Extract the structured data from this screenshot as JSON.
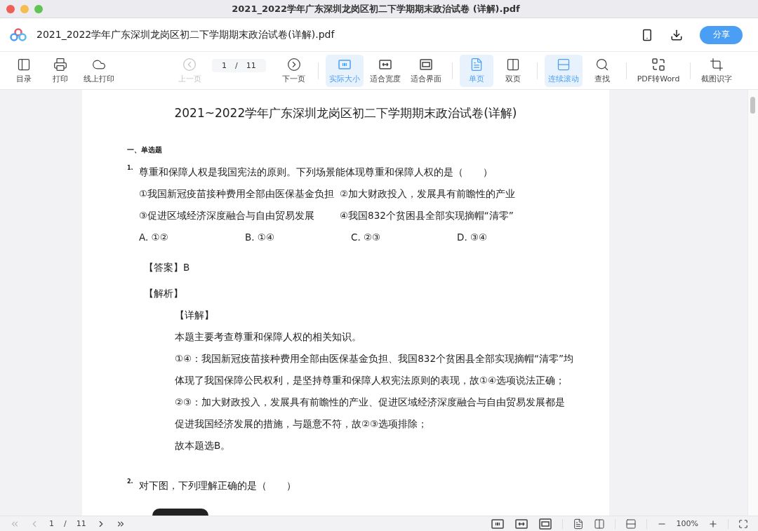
{
  "window": {
    "title": "2021_2022学年广东深圳龙岗区初二下学期期末政治试卷 (详解).pdf"
  },
  "header": {
    "file_name": "2021_2022学年广东深圳龙岗区初二下学期期末政治试卷(详解).pdf",
    "share_button": "分享"
  },
  "toolbar": [
    {
      "kind": "button",
      "label": "目录",
      "selected": false,
      "disabled": false
    },
    {
      "kind": "button",
      "label": "打印",
      "selected": false,
      "disabled": false
    },
    {
      "kind": "button",
      "label": "线上打印",
      "selected": false,
      "disabled": false
    },
    {
      "kind": "spacer"
    },
    {
      "kind": "button",
      "label": "上一页",
      "selected": false,
      "disabled": true
    },
    {
      "kind": "pager",
      "current": "1",
      "separator": "/",
      "total": "11"
    },
    {
      "kind": "button",
      "label": "下一页",
      "selected": false,
      "disabled": false
    },
    {
      "kind": "divider"
    },
    {
      "kind": "button",
      "label": "实际大小",
      "selected": true,
      "disabled": false
    },
    {
      "kind": "button",
      "label": "适合宽度",
      "selected": false,
      "disabled": false
    },
    {
      "kind": "button",
      "label": "适合界面",
      "selected": false,
      "disabled": false
    },
    {
      "kind": "divider"
    },
    {
      "kind": "button",
      "label": "单页",
      "selected": true,
      "disabled": false
    },
    {
      "kind": "button",
      "label": "双页",
      "selected": false,
      "disabled": false
    },
    {
      "kind": "divider"
    },
    {
      "kind": "button",
      "label": "连续滚动",
      "selected": true,
      "disabled": false
    },
    {
      "kind": "button",
      "label": "查找",
      "selected": false,
      "disabled": false
    },
    {
      "kind": "divider"
    },
    {
      "kind": "button",
      "label": "PDF转Word",
      "selected": false,
      "disabled": false
    },
    {
      "kind": "divider"
    },
    {
      "kind": "button",
      "label": "截图识字",
      "selected": false,
      "disabled": false
    }
  ],
  "document": {
    "title": "2021~2022学年广东深圳龙岗区初二下学期期末政治试卷(详解)",
    "section": "一、单选题",
    "question_1": {
      "number": "1.",
      "stem": "尊重和保障人权是我国宪法的原则。下列场景能体现尊重和保障人权的是（　　）",
      "statements": [
        [
          "①我国新冠疫苗接种费用全部由医保基金负担",
          "②加大财政投入，发展具有前瞻性的产业"
        ],
        [
          "③促进区域经济深度融合与自由贸易发展",
          "④我国832个贫困县全部实现摘帽“清零”"
        ]
      ],
      "choices": [
        "A. ①②",
        "B. ①④",
        "C. ②③",
        "D. ③④"
      ],
      "answer_label": "【答案】",
      "answer": "B",
      "analysis_label": "【解析】",
      "detail_label": "【详解】",
      "detail": [
        "本题主要考查尊重和保障人权的相关知识。",
        "①④：我国新冠疫苗接种费用全部由医保基金负担、我国832个贫困县全部实现摘帽“清零”均",
        "体现了我国保障公民权利，是坚持尊重和保障人权宪法原则的表现，故①④选项说法正确；",
        "②③：加大财政投入，发展具有前瞻性的产业、促进区域经济深度融合与自由贸易发展都是",
        "促进我国经济发展的措施，与题意不符，故②③选项排除；",
        "故本题选B。"
      ]
    },
    "question_2": {
      "number": "2.",
      "stem": "对下图，下列理解正确的是（　　）"
    }
  },
  "bottom_bar": {
    "current": "1",
    "separator": "/",
    "total": "11",
    "zoom": "100%"
  }
}
